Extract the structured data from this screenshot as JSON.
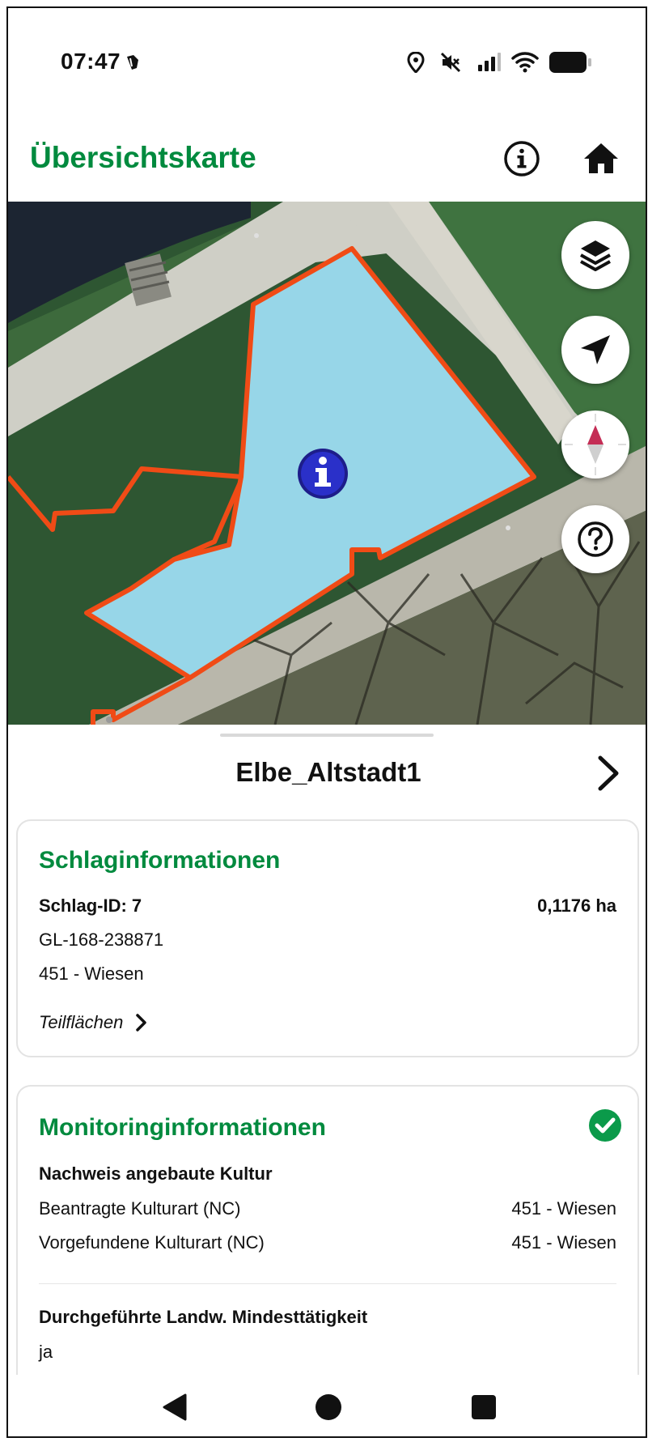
{
  "status_bar": {
    "time": "07:47",
    "icons": [
      "notification-icon",
      "location-icon",
      "mute-icon",
      "signal-icon",
      "wifi-icon",
      "battery-icon"
    ]
  },
  "app_bar": {
    "title": "Übersichtskarte",
    "actions": [
      "info-icon",
      "home-icon"
    ]
  },
  "map": {
    "field_color": "#97d6e8",
    "border_color": "#f04b16",
    "controls": [
      "layers-icon",
      "navigate-icon",
      "compass-icon",
      "help-icon"
    ]
  },
  "sheet": {
    "title": "Elbe_Altstadt1"
  },
  "schlag": {
    "heading": "Schlaginformationen",
    "id_label": "Schlag-ID: 7",
    "area": "0,1176 ha",
    "gl_id": "GL-168-238871",
    "usage": "451 - Wiesen",
    "sub_areas_label": "Teilflächen"
  },
  "monitoring": {
    "heading": "Monitoringinformationen",
    "status": "ok",
    "crop_proof_label": "Nachweis angebaute Kultur",
    "requested_label": "Beantragte Kulturart (NC)",
    "requested_value": "451 - Wiesen",
    "found_label": "Vorgefundene Kulturart (NC)",
    "found_value": "451 - Wiesen",
    "min_activity_label": "Durchgeführte Landw. Mindesttätigkeit",
    "min_activity_value": "ja"
  },
  "colors": {
    "accent": "#008a3e",
    "check": "#0b9a4a"
  }
}
